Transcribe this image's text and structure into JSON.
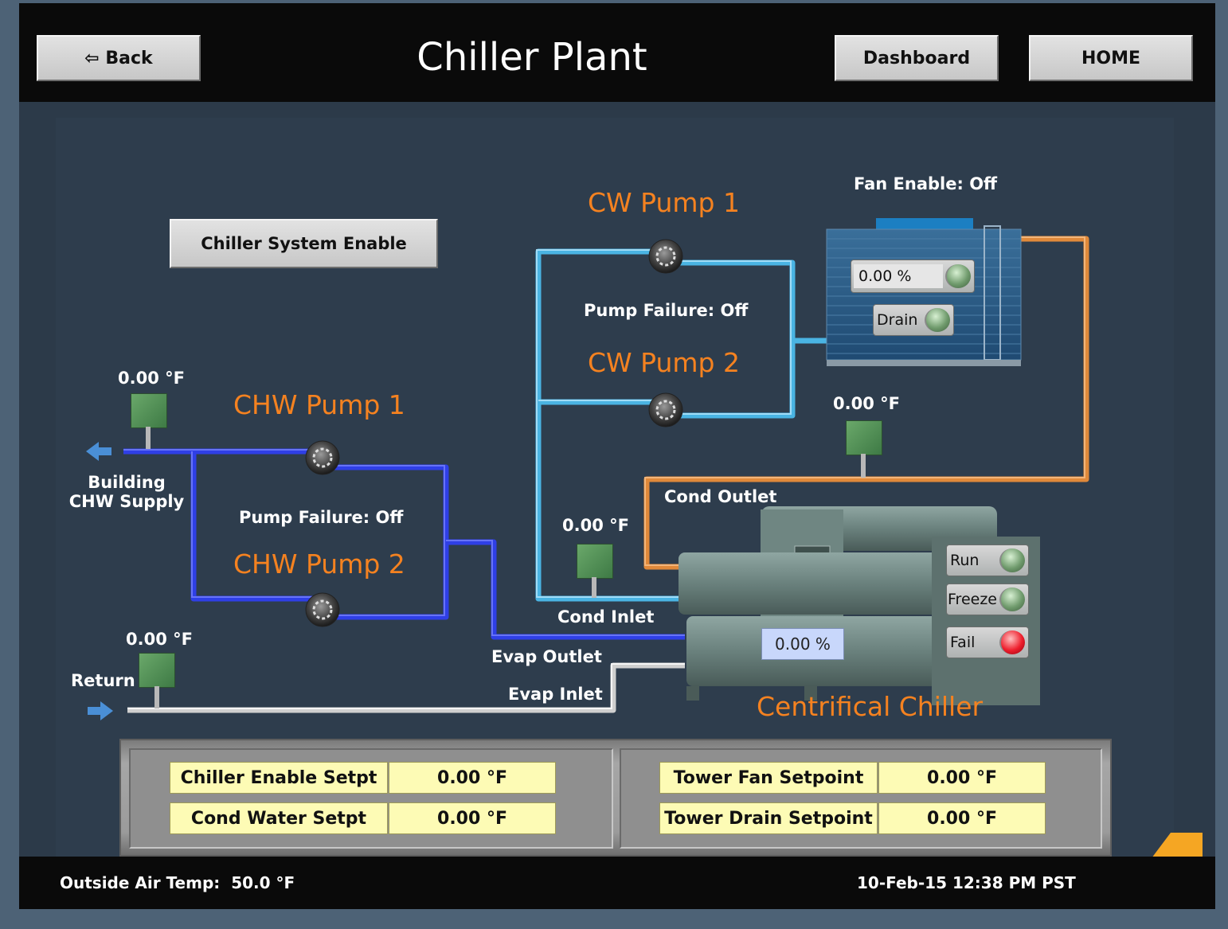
{
  "header": {
    "title": "Chiller Plant",
    "back_label": "⇦ Back",
    "dashboard_label": "Dashboard",
    "home_label": "HOME"
  },
  "system_enable_label": "Chiller System Enable",
  "chw": {
    "pump1_label": "CHW Pump 1",
    "pump2_label": "CHW Pump 2",
    "pump_failure": "Pump Failure: Off",
    "supply_temp": "0.00 °F",
    "return_temp": "0.00 °F",
    "supply_label_line1": "Building",
    "supply_label_line2": "CHW Supply",
    "return_label": "Return"
  },
  "cw": {
    "pump1_label": "CW Pump 1",
    "pump2_label": "CW Pump 2",
    "pump_failure": "Pump Failure: Off",
    "cond_inlet_temp": "0.00 °F",
    "cond_outlet_temp": "0.00 °F"
  },
  "tower": {
    "fan_enable": "Fan Enable: Off",
    "fan_percent": "0.00 %",
    "drain_label": "Drain"
  },
  "chiller": {
    "name": "Centrifical Chiller",
    "load_percent": "0.00 %",
    "run_label": "Run",
    "freeze_label": "Freeze",
    "fail_label": "Fail"
  },
  "pipe_labels": {
    "cond_outlet": "Cond Outlet",
    "cond_inlet": "Cond Inlet",
    "evap_outlet": "Evap Outlet",
    "evap_inlet": "Evap Inlet"
  },
  "setpoints": {
    "left": [
      {
        "label": "Chiller Enable Setpt",
        "value": "0.00 °F"
      },
      {
        "label": "Cond Water Setpt",
        "value": "0.00 °F"
      }
    ],
    "right": [
      {
        "label": "Tower Fan Setpoint",
        "value": "0.00 °F"
      },
      {
        "label": "Tower Drain Setpoint",
        "value": "0.00 °F"
      }
    ]
  },
  "footer": {
    "outside_air": "Outside Air Temp:  50.0 °F",
    "datetime": "10-Feb-15 12:38 PM PST"
  },
  "colors": {
    "chw_pipe": "#2f3fe6",
    "cw_pipe": "#4ab4e3",
    "cond_pipe": "#e0893a",
    "return_pipe": "#cfcfcf",
    "accent_orange": "#f58220"
  }
}
